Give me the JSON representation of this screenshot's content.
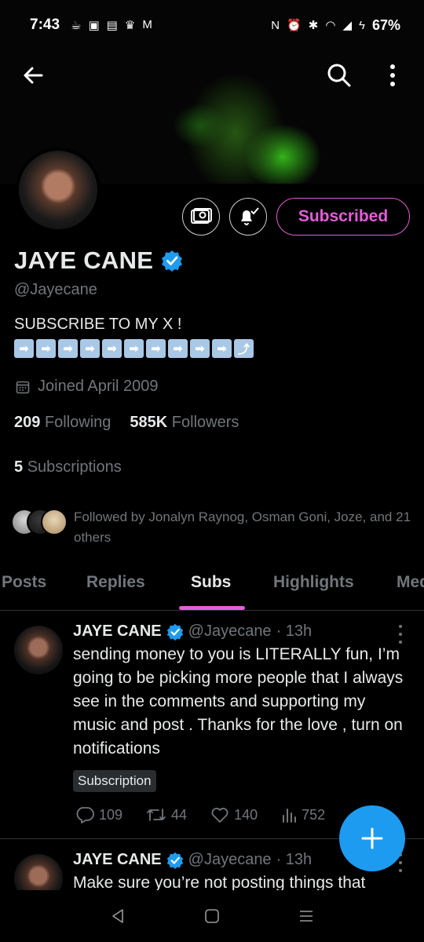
{
  "status_bar": {
    "time": "7:43",
    "battery": "67%"
  },
  "profile": {
    "name": "JAYE CANE",
    "handle": "@Jayecane",
    "bio": "SUBSCRIBE TO MY X !",
    "joined": "Joined April 2009",
    "following_count": "209",
    "following_label": "Following",
    "followers_count": "585K",
    "followers_label": "Followers",
    "subscriptions_count": "5",
    "subscriptions_label": "Subscriptions",
    "followed_by": "Followed by Jonalyn Raynog, Osman Goni, Joze, and 21 others",
    "subscribed_button": "Subscribed"
  },
  "colors": {
    "accent": "#e25ed6",
    "verified": "#1d9bf0",
    "muted": "#71767b",
    "fab": "#1d9bf0"
  },
  "tabs": [
    {
      "label": "Posts"
    },
    {
      "label": "Replies"
    },
    {
      "label": "Subs"
    },
    {
      "label": "Highlights"
    },
    {
      "label": "Media"
    }
  ],
  "active_tab": "Subs",
  "posts": [
    {
      "name": "JAYE CANE",
      "handle": "@Jayecane",
      "time": "· 13h",
      "text": "sending money to you is LITERALLY fun, I’m going to be picking more people that I always see in the comments and supporting my music and post . Thanks for the love , turn on notifications",
      "tag": "Subscription",
      "replies": "109",
      "reposts": "44",
      "likes": "140",
      "views": "752"
    },
    {
      "name": "JAYE CANE",
      "handle": "@Jayecane",
      "time": "· 13h",
      "text": "Make sure you’re not posting things that"
    }
  ]
}
